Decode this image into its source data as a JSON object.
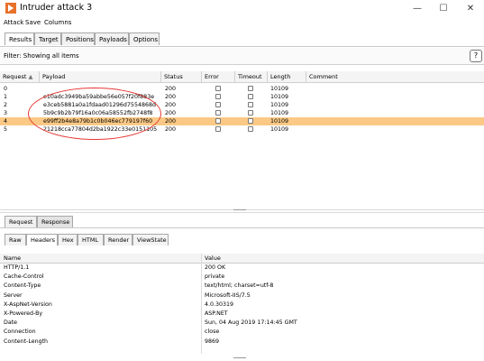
{
  "window": {
    "title": "Intruder attack 3",
    "minimize": "—",
    "maximize": "☐",
    "close": "✕"
  },
  "menu": [
    "Attack",
    "Save",
    "Columns"
  ],
  "tabs": [
    "Results",
    "Target",
    "Positions",
    "Payloads",
    "Options"
  ],
  "filter": {
    "label": "Filter: Showing all items",
    "help": "?"
  },
  "table": {
    "columns": [
      "Request",
      "▲",
      "Payload",
      "Status",
      "Error",
      "Timeout",
      "Length",
      "Comment"
    ],
    "rows": [
      {
        "request": "0",
        "payload": "",
        "status": "200",
        "length": "10109"
      },
      {
        "request": "1",
        "payload": "e10adc3949ba59abbe56e057f20f883e",
        "status": "200",
        "length": "10109"
      },
      {
        "request": "2",
        "payload": "e3ceb5881a0a1fdaad01296d7554868d",
        "status": "200",
        "length": "10109"
      },
      {
        "request": "3",
        "payload": "5b9c9b2b79f16a0c06a58552fb2748f8",
        "status": "200",
        "length": "10109"
      },
      {
        "request": "4",
        "payload": "e99ff2b4e8a79b1c0b046ec779197f60",
        "status": "200",
        "length": "10109",
        "selected": true
      },
      {
        "request": "5",
        "payload": "21218cca77804d2ba1922c33e0151105",
        "status": "200",
        "length": "10109"
      }
    ]
  },
  "detail_tabs": [
    "Request",
    "Response"
  ],
  "sub_tabs": [
    "Raw",
    "Headers",
    "Hex",
    "HTML",
    "Render",
    "ViewState"
  ],
  "headers_table": {
    "columns": [
      "Name",
      "Value"
    ],
    "rows": [
      [
        "HTTP/1.1",
        "200 OK"
      ],
      [
        "Cache-Control",
        "private"
      ],
      [
        "Content-Type",
        "text/html; charset=utf-8"
      ],
      [
        "Server",
        "Microsoft-IIS/7.5"
      ],
      [
        "X-AspNet-Version",
        "4.0.30319"
      ],
      [
        "X-Powered-By",
        "ASP.NET"
      ],
      [
        "Date",
        "Sun, 04 Aug 2019 17:14:45 GMT"
      ],
      [
        "Connection",
        "close"
      ],
      [
        "Content-Length",
        "9869"
      ]
    ]
  },
  "colors": {
    "selected_row": "#fbc985",
    "annotation": "#e53935",
    "app_icon": "#e8712b"
  }
}
